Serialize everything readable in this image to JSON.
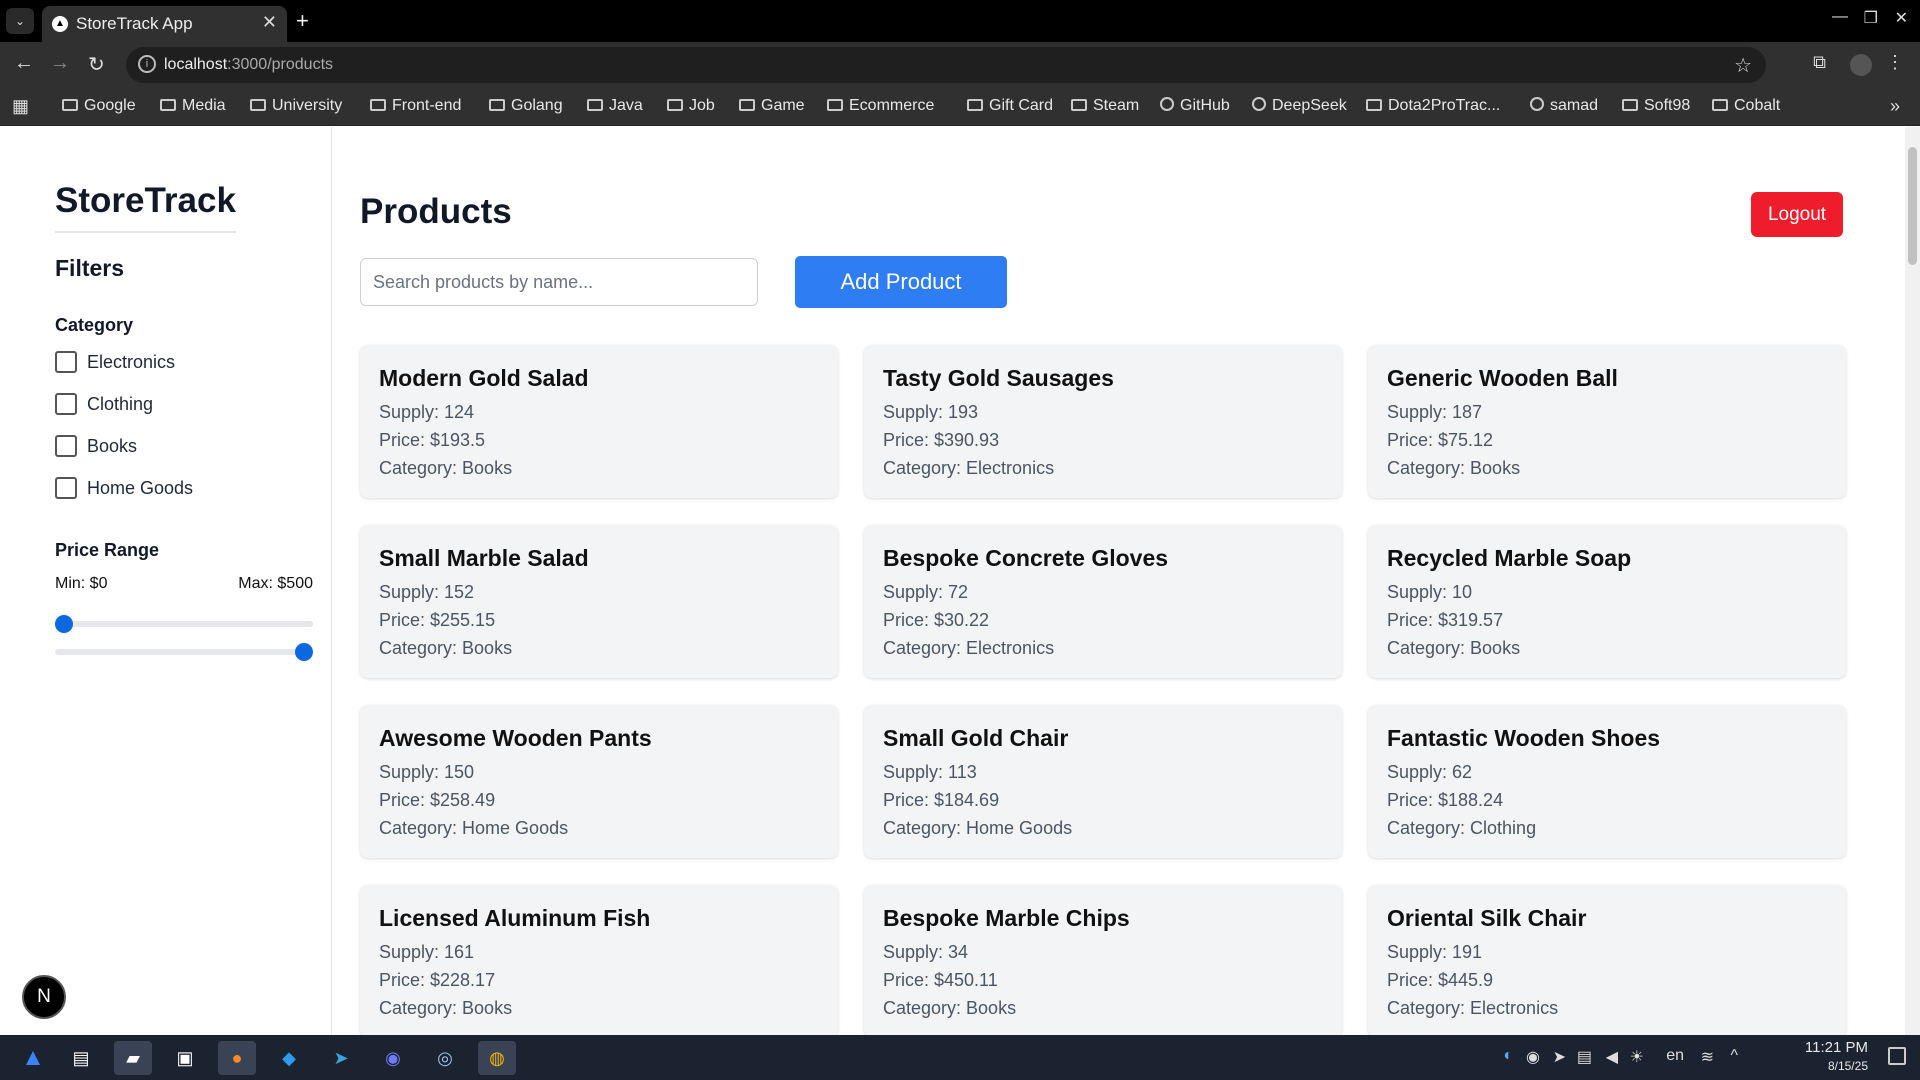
{
  "browser": {
    "tab_title": "StoreTrack App",
    "tab_favicon": "▲",
    "url_host": "localhost",
    "url_path": ":3000/products"
  },
  "bookmarks": [
    "Google",
    "Media",
    "University",
    "Front-end",
    "Golang",
    "Java",
    "Job",
    "Game",
    "Ecommerce",
    "Gift Card",
    "Steam",
    "GitHub",
    "DeepSeek",
    "Dota2ProTrac...",
    "samad",
    "Soft98",
    "Cobalt"
  ],
  "sidebar": {
    "brand": "StoreTrack",
    "filters_heading": "Filters",
    "category_heading": "Category",
    "categories": [
      "Electronics",
      "Clothing",
      "Books",
      "Home Goods"
    ],
    "price_heading": "Price Range",
    "min_label": "Min: $0",
    "max_label": "Max: $500",
    "price_min": 0,
    "price_max": 500
  },
  "main": {
    "title": "Products",
    "logout_label": "Logout",
    "search_placeholder": "Search products by name...",
    "add_label": "Add Product"
  },
  "products": [
    {
      "name": "Modern Gold Salad",
      "supply": "Supply: 124",
      "price": "Price: $193.5",
      "category": "Category: Books"
    },
    {
      "name": "Tasty Gold Sausages",
      "supply": "Supply: 193",
      "price": "Price: $390.93",
      "category": "Category: Electronics"
    },
    {
      "name": "Generic Wooden Ball",
      "supply": "Supply: 187",
      "price": "Price: $75.12",
      "category": "Category: Books"
    },
    {
      "name": "Small Marble Salad",
      "supply": "Supply: 152",
      "price": "Price: $255.15",
      "category": "Category: Books"
    },
    {
      "name": "Bespoke Concrete Gloves",
      "supply": "Supply: 72",
      "price": "Price: $30.22",
      "category": "Category: Electronics"
    },
    {
      "name": "Recycled Marble Soap",
      "supply": "Supply: 10",
      "price": "Price: $319.57",
      "category": "Category: Books"
    },
    {
      "name": "Awesome Wooden Pants",
      "supply": "Supply: 150",
      "price": "Price: $258.49",
      "category": "Category: Home Goods"
    },
    {
      "name": "Small Gold Chair",
      "supply": "Supply: 113",
      "price": "Price: $184.69",
      "category": "Category: Home Goods"
    },
    {
      "name": "Fantastic Wooden Shoes",
      "supply": "Supply: 62",
      "price": "Price: $188.24",
      "category": "Category: Clothing"
    },
    {
      "name": "Licensed Aluminum Fish",
      "supply": "Supply: 161",
      "price": "Price: $228.17",
      "category": "Category: Books"
    },
    {
      "name": "Bespoke Marble Chips",
      "supply": "Supply: 34",
      "price": "Price: $450.11",
      "category": "Category: Books"
    },
    {
      "name": "Oriental Silk Chair",
      "supply": "Supply: 191",
      "price": "Price: $445.9",
      "category": "Category: Electronics"
    }
  ],
  "dev_badge": "N",
  "taskbar": {
    "lang": "en",
    "time": "11:21 PM",
    "date": "8/15/25"
  },
  "colors": {
    "accent": "#2f7df2",
    "danger": "#ef1c2c",
    "card_bg": "#f3f4f6"
  }
}
